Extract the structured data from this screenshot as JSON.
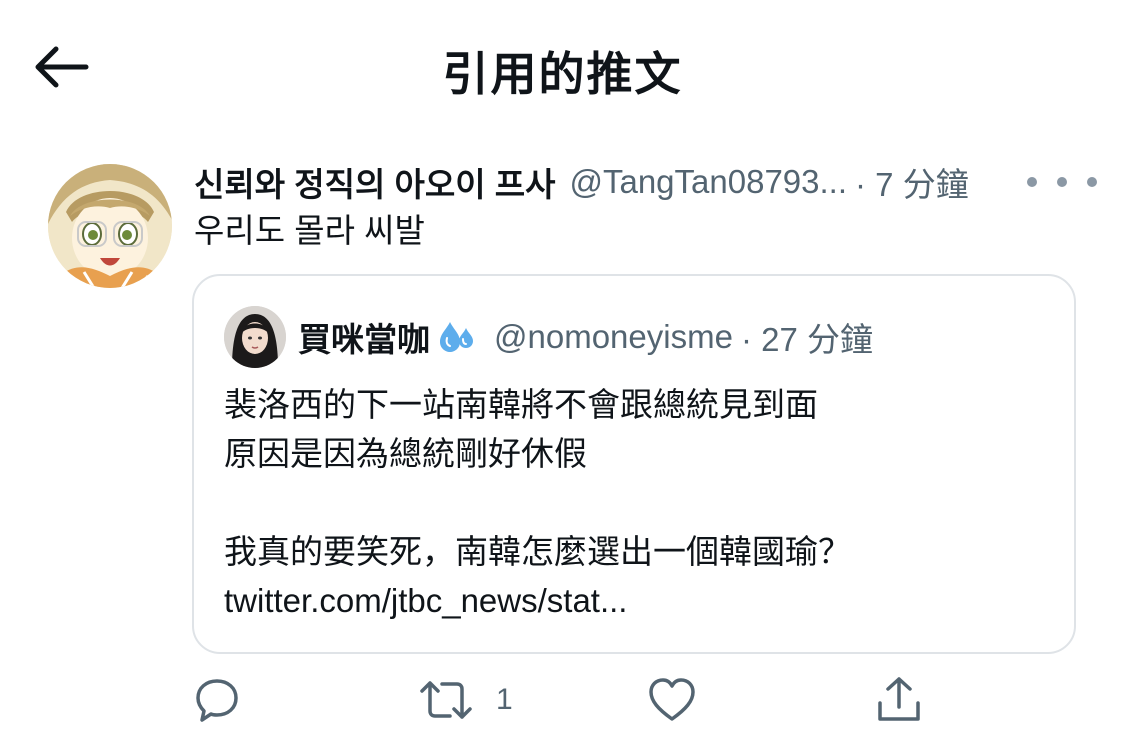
{
  "header": {
    "title": "引用的推文"
  },
  "tweet": {
    "display_name": "신뢰와 정직의 아오이 프사",
    "handle": "@TangTan08793...",
    "time": "· 7 分鐘",
    "text": "우리도 몰라 씨발"
  },
  "quoted_tweet": {
    "display_name": "買咪當咖",
    "handle": "@nomoneyisme",
    "time": "· 27 分鐘",
    "lines": [
      "裴洛西的下一站南韓將不會跟總統見到面",
      "原因是因為總統剛好休假",
      "",
      "我真的要笑死，南韓怎麼選出一個韓國瑜？",
      "twitter.com/jtbc_news/stat..."
    ]
  },
  "actions": {
    "reply_count": "",
    "retweet_count": "1",
    "like_count": "",
    "icons": [
      "back-arrow-icon",
      "more-icon",
      "reply-icon",
      "retweet-icon",
      "like-icon",
      "share-icon",
      "sweat-droplets-icon"
    ]
  },
  "colors": {
    "text_primary": "#0f1419",
    "text_secondary": "#536471",
    "border": "#dfe3e7",
    "background": "#ffffff"
  }
}
